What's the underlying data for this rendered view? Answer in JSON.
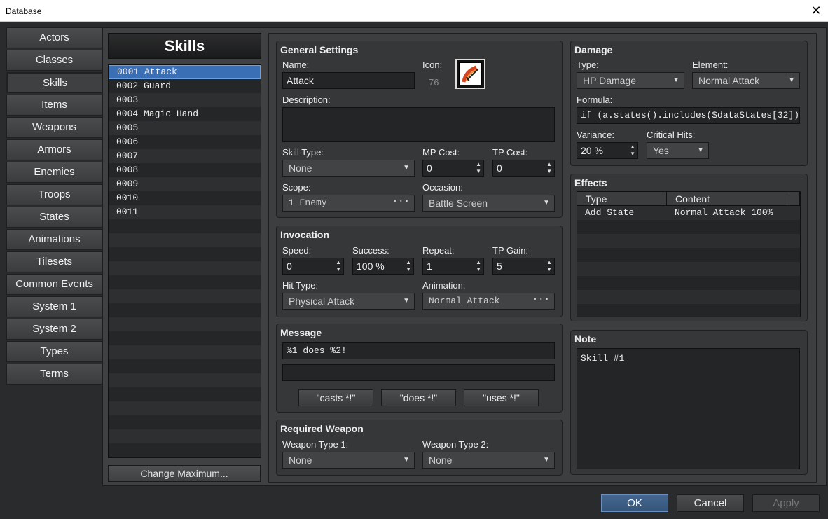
{
  "window": {
    "title": "Database",
    "close_glyph": "✕"
  },
  "nav": [
    "Actors",
    "Classes",
    "Skills",
    "Items",
    "Weapons",
    "Armors",
    "Enemies",
    "Troops",
    "States",
    "Animations",
    "Tilesets",
    "Common Events",
    "System 1",
    "System 2",
    "Types",
    "Terms"
  ],
  "nav_active": "Skills",
  "list": {
    "header": "Skills",
    "items": [
      "0001 Attack",
      "0002 Guard",
      "0003",
      "0004 Magic Hand",
      "0005",
      "0006",
      "0007",
      "0008",
      "0009",
      "0010",
      "0011",
      "",
      "",
      "",
      "",
      "",
      "",
      "",
      "",
      "",
      "",
      "",
      "",
      "",
      "",
      "",
      "",
      ""
    ],
    "selected_index": 0,
    "change_max_label": "Change Maximum..."
  },
  "general": {
    "title": "General Settings",
    "name_label": "Name:",
    "name_value": "Attack",
    "icon_label": "Icon:",
    "icon_index": "76",
    "icon_name": "sword-slash-icon",
    "description_label": "Description:",
    "description_value": "",
    "skill_type_label": "Skill Type:",
    "skill_type_value": "None",
    "mp_cost_label": "MP Cost:",
    "mp_cost_value": "0",
    "tp_cost_label": "TP Cost:",
    "tp_cost_value": "0",
    "scope_label": "Scope:",
    "scope_value": "1 Enemy",
    "occasion_label": "Occasion:",
    "occasion_value": "Battle Screen"
  },
  "invocation": {
    "title": "Invocation",
    "speed_label": "Speed:",
    "speed_value": "0",
    "success_label": "Success:",
    "success_value": "100 %",
    "repeat_label": "Repeat:",
    "repeat_value": "1",
    "tp_gain_label": "TP Gain:",
    "tp_gain_value": "5",
    "hit_type_label": "Hit Type:",
    "hit_type_value": "Physical Attack",
    "animation_label": "Animation:",
    "animation_value": "Normal Attack"
  },
  "message": {
    "title": "Message",
    "line1": "%1 does %2!",
    "line2": "",
    "btn_casts": "\"casts *!\"",
    "btn_does": "\"does *!\"",
    "btn_uses": "\"uses *!\""
  },
  "required_weapon": {
    "title": "Required Weapon",
    "type1_label": "Weapon Type 1:",
    "type1_value": "None",
    "type2_label": "Weapon Type 2:",
    "type2_value": "None"
  },
  "damage": {
    "title": "Damage",
    "type_label": "Type:",
    "type_value": "HP Damage",
    "element_label": "Element:",
    "element_value": "Normal Attack",
    "formula_label": "Formula:",
    "formula_value": "if (a.states().includes($dataStates[32])) {b",
    "variance_label": "Variance:",
    "variance_value": "20 %",
    "critical_label": "Critical Hits:",
    "critical_value": "Yes"
  },
  "effects": {
    "title": "Effects",
    "col_type": "Type",
    "col_content": "Content",
    "rows": [
      {
        "type": "Add State",
        "content": "Normal Attack 100%"
      }
    ]
  },
  "note": {
    "title": "Note",
    "value": "Skill #1"
  },
  "buttons": {
    "ok": "OK",
    "cancel": "Cancel",
    "apply": "Apply"
  },
  "colors": {
    "accent": "#3a6fb6",
    "ok_button": "#3b5f8a"
  }
}
